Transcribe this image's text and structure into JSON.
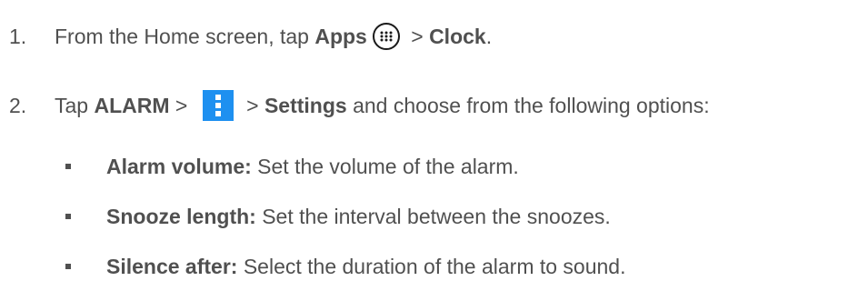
{
  "steps": [
    {
      "number": "1.",
      "text_before": "From the Home screen, tap ",
      "apps_label": "Apps",
      "apps_icon": "apps-grid-icon",
      "separator": " > ",
      "clock_label": "Clock",
      "end": "."
    },
    {
      "number": "2.",
      "text_before": "Tap ",
      "alarm_label": "ALARM",
      "separator1": " > ",
      "menu_icon": "more-vert-icon",
      "separator2": " > ",
      "settings_label": "Settings",
      "text_after": " and choose from the following options:"
    }
  ],
  "options": [
    {
      "label": "Alarm volume:",
      "description": " Set the volume of the alarm."
    },
    {
      "label": "Snooze length:",
      "description": " Set the interval between the snoozes."
    },
    {
      "label": "Silence after:",
      "description": " Select the duration of the alarm to sound."
    }
  ],
  "colors": {
    "text": "#505050",
    "menu_icon_bg": "#1e90f0"
  }
}
